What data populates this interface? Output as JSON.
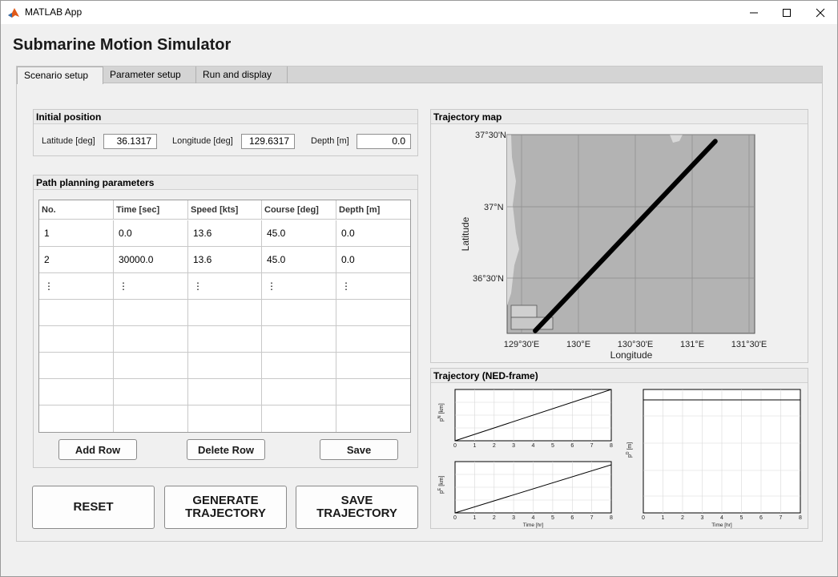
{
  "window": {
    "title": "MATLAB App"
  },
  "app": {
    "heading": "Submarine Motion Simulator"
  },
  "tabs": [
    {
      "label": "Scenario setup",
      "active": true
    },
    {
      "label": "Parameter setup",
      "active": false
    },
    {
      "label": "Run and display",
      "active": false
    }
  ],
  "initial_position": {
    "title": "Initial position",
    "latitude": {
      "label": "Latitude [deg]",
      "value": "36.1317"
    },
    "longitude": {
      "label": "Longitude [deg]",
      "value": "129.6317"
    },
    "depth": {
      "label": "Depth [m]",
      "value": "0.0"
    }
  },
  "path_planning": {
    "title": "Path planning parameters",
    "columns": [
      "No.",
      "Time [sec]",
      "Speed [kts]",
      "Course [deg]",
      "Depth [m]"
    ],
    "rows": [
      [
        "1",
        "0.0",
        "13.6",
        "45.0",
        "0.0"
      ],
      [
        "2",
        "30000.0",
        "13.6",
        "45.0",
        "0.0"
      ],
      [
        "⋮",
        "⋮",
        "⋮",
        "⋮",
        "⋮"
      ],
      [
        "",
        "",
        "",
        "",
        ""
      ],
      [
        "",
        "",
        "",
        "",
        ""
      ],
      [
        "",
        "",
        "",
        "",
        ""
      ],
      [
        "",
        "",
        "",
        "",
        ""
      ],
      [
        "",
        "",
        "",
        "",
        ""
      ]
    ],
    "add_row_label": "Add Row",
    "delete_row_label": "Delete Row",
    "save_label": "Save"
  },
  "actions": {
    "reset_label": "RESET",
    "generate_label_1": "GENERATE",
    "generate_label_2": "TRAJECTORY",
    "save_label_1": "SAVE",
    "save_label_2": "TRAJECTORY"
  },
  "trajectory_map": {
    "title": "Trajectory map",
    "xlabel": "Longitude",
    "ylabel": "Latitude",
    "xticks": [
      "129°30'E",
      "130°E",
      "130°30'E",
      "131°E",
      "131°30'E"
    ],
    "yticks": [
      "37°30'N",
      "37°N",
      "36°30'N"
    ],
    "colors": {
      "sea": "#b3b3b3",
      "land": "#d9d9d9",
      "track": "#000000"
    }
  },
  "chart_data": [
    {
      "type": "line",
      "title": "",
      "xlabel": "Longitude",
      "ylabel": "Latitude",
      "xlim": [
        129.4,
        131.6
      ],
      "ylim": [
        36.0,
        37.5
      ],
      "series": [
        {
          "x": [
            129.65,
            131.25
          ],
          "y": [
            36.02,
            37.45
          ]
        }
      ]
    },
    {
      "type": "line",
      "xlabel": "",
      "ylabel": "p^N [km]",
      "x": [
        0,
        8
      ],
      "xticks": [
        "0",
        "1",
        "2",
        "3",
        "4",
        "5",
        "6",
        "7",
        "8"
      ],
      "series": [
        {
          "values": [
            0,
            1
          ]
        }
      ]
    },
    {
      "type": "line",
      "xlabel": "Time [hr]",
      "ylabel": "p^E [km]",
      "x": [
        0,
        8
      ],
      "xticks": [
        "0",
        "1",
        "2",
        "3",
        "4",
        "5",
        "6",
        "7",
        "8"
      ],
      "series": [
        {
          "values": [
            0,
            1
          ]
        }
      ]
    },
    {
      "type": "line",
      "xlabel": "Time [hr]",
      "ylabel": "p^D [m]",
      "x": [
        0,
        8
      ],
      "xticks": [
        "0",
        "1",
        "2",
        "3",
        "4",
        "5",
        "6",
        "7",
        "8"
      ],
      "series": [
        {
          "values": [
            0,
            0
          ]
        }
      ]
    }
  ],
  "ned": {
    "title": "Trajectory (NED-frame)",
    "pn_label": "p",
    "pn_sup": "N",
    "pn_unit": " [km]",
    "pe_label": "p",
    "pe_sup": "E",
    "pe_unit": " [km]",
    "pd_label": "p",
    "pd_sup": "D",
    "pd_unit": " [m]",
    "time_label": "Time [hr]"
  }
}
